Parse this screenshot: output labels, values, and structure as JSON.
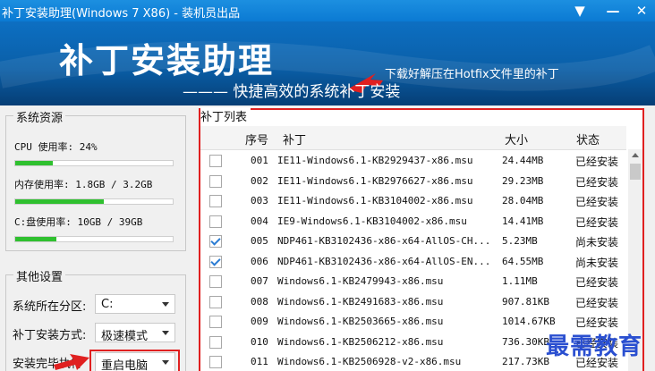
{
  "window": {
    "title": "补丁安装助理(Windows 7 X86) - 装机员出品",
    "controls": [
      "▼",
      "—",
      "✕"
    ]
  },
  "banner": {
    "title": "补丁安装助理",
    "subtitle": "——— 快捷高效的系统补丁安装",
    "annotation": "下载好解压在Hotfix文件里的补丁"
  },
  "resources": {
    "title": "系统资源",
    "cpu": {
      "label": "CPU 使用率: 24%",
      "percent": 24
    },
    "memory": {
      "label": "内存使用率: 1.8GB / 3.2GB",
      "percent": 56
    },
    "disk": {
      "label": "C:盘使用率: 10GB / 39GB",
      "percent": 26
    }
  },
  "settings": {
    "title": "其他设置",
    "partition": {
      "label": "系统所在分区:",
      "value": "C:"
    },
    "mode": {
      "label": "补丁安装方式:",
      "value": "极速模式"
    },
    "after": {
      "label": "安装完毕执行",
      "value": "重启电脑"
    }
  },
  "patches": {
    "title": "补丁列表",
    "columns": {
      "index": "序号",
      "name": "补丁",
      "size": "大小",
      "status": "状态"
    },
    "rows": [
      {
        "checked": false,
        "index": "001",
        "name": "IE11-Windows6.1-KB2929437-x86.msu",
        "size": "24.44MB",
        "status": "已经安装"
      },
      {
        "checked": false,
        "index": "002",
        "name": "IE11-Windows6.1-KB2976627-x86.msu",
        "size": "29.23MB",
        "status": "已经安装"
      },
      {
        "checked": false,
        "index": "003",
        "name": "IE11-Windows6.1-KB3104002-x86.msu",
        "size": "28.04MB",
        "status": "已经安装"
      },
      {
        "checked": false,
        "index": "004",
        "name": "IE9-Windows6.1-KB3104002-x86.msu",
        "size": "14.41MB",
        "status": "已经安装"
      },
      {
        "checked": true,
        "index": "005",
        "name": "NDP461-KB3102436-x86-x64-AllOS-CH...",
        "size": "5.23MB",
        "status": "尚未安装"
      },
      {
        "checked": true,
        "index": "006",
        "name": "NDP461-KB3102436-x86-x64-AllOS-EN...",
        "size": "64.55MB",
        "status": "尚未安装"
      },
      {
        "checked": false,
        "index": "007",
        "name": "Windows6.1-KB2479943-x86.msu",
        "size": "1.11MB",
        "status": "已经安装"
      },
      {
        "checked": false,
        "index": "008",
        "name": "Windows6.1-KB2491683-x86.msu",
        "size": "907.81KB",
        "status": "已经安装"
      },
      {
        "checked": false,
        "index": "009",
        "name": "Windows6.1-KB2503665-x86.msu",
        "size": "1014.67KB",
        "status": "已经安装"
      },
      {
        "checked": false,
        "index": "010",
        "name": "Windows6.1-KB2506212-x86.msu",
        "size": "736.30KB",
        "status": "已经安装"
      },
      {
        "checked": false,
        "index": "011",
        "name": "Windows6.1-KB2506928-v2-x86.msu",
        "size": "217.73KB",
        "status": "已经安装"
      }
    ]
  },
  "watermark": "最需教育"
}
